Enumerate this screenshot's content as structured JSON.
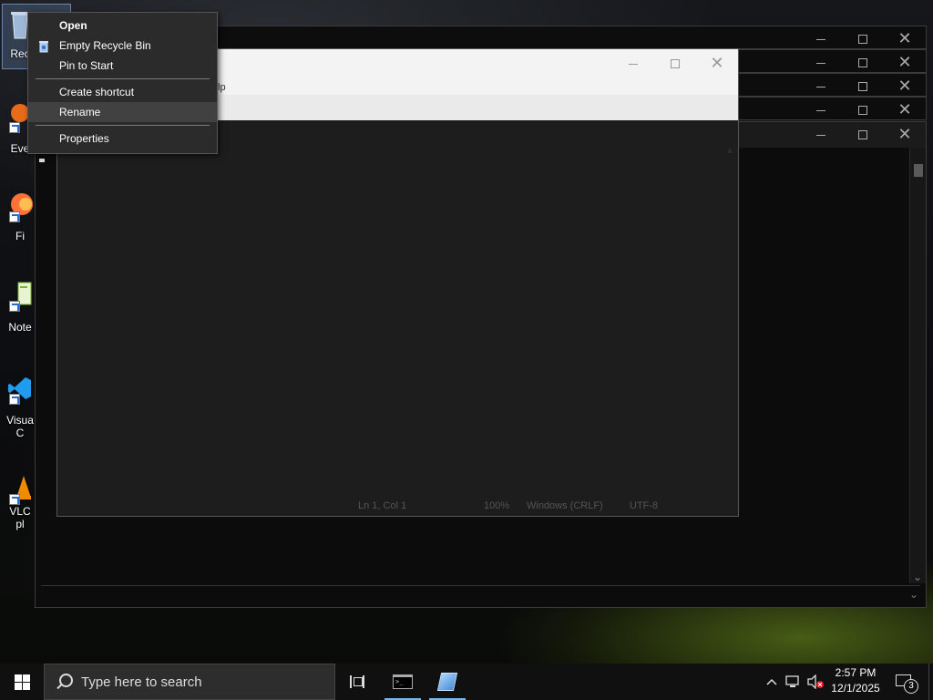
{
  "desktop": {
    "icons": [
      {
        "label": "Rec"
      },
      {
        "label": "Eve"
      },
      {
        "label": "Fi"
      },
      {
        "label": "Note"
      },
      {
        "label": "Visua"
      },
      {
        "label": "C"
      },
      {
        "label": "VLC"
      },
      {
        "label": "pl"
      }
    ]
  },
  "context_menu": {
    "items": [
      {
        "label": "Open",
        "bold": true
      },
      {
        "label": "Empty Recycle Bin"
      },
      {
        "label": "Pin to Start"
      },
      {
        "label": "Create shortcut"
      },
      {
        "label": "Rename",
        "hover": true
      },
      {
        "label": "Properties"
      }
    ]
  },
  "notepad_window": {
    "menu_fragment": "lp",
    "status": {
      "position": "Ln 1, Col 1",
      "zoom": "100%",
      "line_ending": "Windows (CRLF)",
      "encoding": "UTF-8"
    }
  },
  "taskbar": {
    "search_placeholder": "Type here to search",
    "clock_time": "2:57 PM",
    "clock_date": "12/1/2025",
    "notification_count": "3"
  },
  "colors": {
    "accent": "#76b9ed",
    "menu_bg": "#2b2b2b",
    "taskbar_bg": "#101010"
  }
}
